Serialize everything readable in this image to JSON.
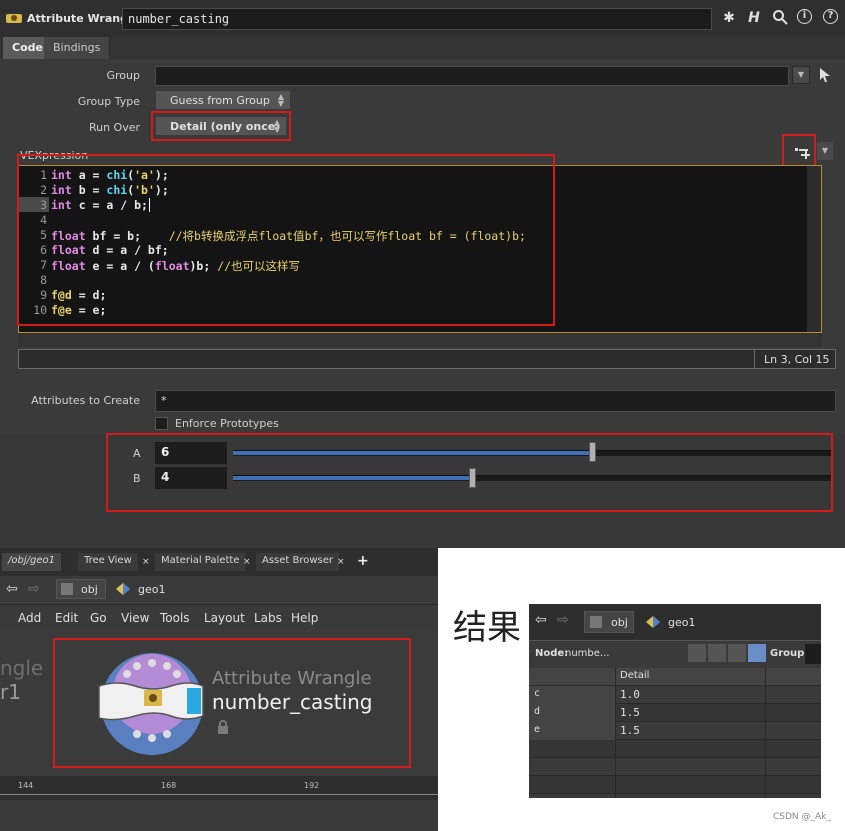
{
  "header": {
    "title": "Attribute Wrangle",
    "node_name": "number_casting",
    "icons": [
      "gear-icon",
      "houdini-h-icon",
      "search-icon",
      "info-icon",
      "help-icon"
    ]
  },
  "tabs": [
    "Code",
    "Bindings"
  ],
  "params": {
    "group_label": "Group",
    "group_value": "",
    "group_type_label": "Group Type",
    "group_type_value": "Guess from Group",
    "run_over_label": "Run Over",
    "run_over_value": "Detail (only once)",
    "vex_label": "VEXpression",
    "attributes_label": "Attributes to Create",
    "attributes_value": "*",
    "enforce_label": "Enforce Prototypes"
  },
  "code": {
    "line_numbers": [
      "1",
      "2",
      "3",
      "4",
      "5",
      "6",
      "7",
      "8",
      "9",
      "10"
    ],
    "l1": {
      "a": "int",
      " b": " a = ",
      "c": "chi",
      "d": "(",
      "e": "'a'",
      "f": ");"
    },
    "l2": {
      "a": "int",
      "b": " b = ",
      "c": "chi",
      "d": "(",
      "e": "'b'",
      "f": ");"
    },
    "l3": {
      "a": "int",
      "b": " c = a / b;"
    },
    "l5": {
      "a": "float",
      "b": " bf = b;",
      "c": "    //将b转换成浮点float值bf，也可以写作float bf = (float)b;"
    },
    "l6": {
      "a": "float",
      "b": " d = a / bf;"
    },
    "l7": {
      "a": "float",
      "b": " e = a / (",
      "c": "float",
      "d": ")b; ",
      "e": "//也可以这样写"
    },
    "l9": {
      "a": "f@d",
      "b": " = d;"
    },
    "l10": {
      "a": "f@e",
      "b": " = e;"
    }
  },
  "status": {
    "cursor": "Ln 3, Col 15"
  },
  "sliders": [
    {
      "label": "A",
      "value": "6",
      "fraction": 0.6
    },
    {
      "label": "B",
      "value": "4",
      "fraction": 0.4
    }
  ],
  "network": {
    "tabs": [
      "/obj/geo1",
      "Tree View",
      "Material Palette",
      "Asset Browser"
    ],
    "add_tab": "+",
    "path": [
      "obj",
      "geo1"
    ],
    "menu": [
      "Add",
      "Edit",
      "Go",
      "View",
      "Tools",
      "Layout",
      "Labs",
      "Help"
    ],
    "side_text_1": "ngle",
    "side_text_2": "r1",
    "node_type": "Attribute Wrangle",
    "node_name": "number_casting",
    "ruler": [
      "144",
      "168",
      "192"
    ]
  },
  "result": {
    "title": "结果",
    "path": [
      "obj",
      "geo1"
    ],
    "node_label": "Node:",
    "node_value": "numbe...",
    "group_label": "Group:",
    "column": "Detail",
    "rows": [
      {
        "name": "c",
        "value": "1.0"
      },
      {
        "name": "d",
        "value": "1.5"
      },
      {
        "name": "e",
        "value": "1.5"
      }
    ]
  },
  "watermark": "CSDN @_Ak_",
  "colors": {
    "highlight": "#d41b1b",
    "slider_fill": "#3f6fb5",
    "code_border": "#b88a3a"
  }
}
